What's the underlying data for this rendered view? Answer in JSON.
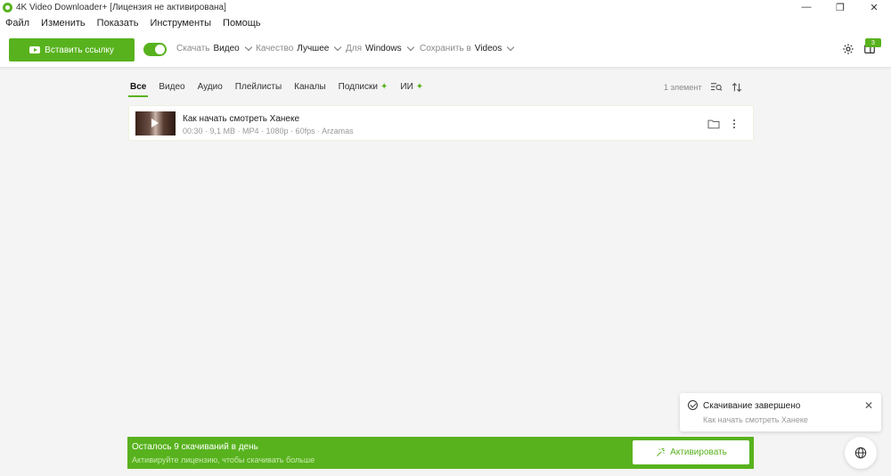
{
  "window": {
    "title": "4K Video Downloader+ [Лицензия не активирована]",
    "minimize": "—",
    "restore": "❐",
    "close": "✕"
  },
  "menu": [
    "Файл",
    "Изменить",
    "Показать",
    "Инструменты",
    "Помощь"
  ],
  "toolbar": {
    "paste_label": "Вставить ссылку",
    "download_label": "Скачать",
    "download_value": "Видео",
    "quality_label": "Качество",
    "quality_value": "Лучшее",
    "for_label": "Для",
    "for_value": "Windows",
    "save_label": "Сохранить в",
    "save_value": "Videos",
    "queue_badge": "3",
    "smart_mode": true
  },
  "tabs": [
    "Все",
    "Видео",
    "Аудио",
    "Плейлисты",
    "Каналы",
    "Подписки",
    "ИИ"
  ],
  "list": {
    "count": "1 элемент",
    "items": [
      {
        "title": "Как начать смотреть Ханеке",
        "meta": "00:30 · 9,1 MB · MP4 · 1080p · 60fps · Arzamas"
      }
    ]
  },
  "toast": {
    "title": "Скачивание завершено",
    "subtitle": "Как начать смотреть Ханеке"
  },
  "banner": {
    "line1": "Осталось 9 скачиваний в день",
    "line2": "Активируйте лицензию, чтобы скачивать больше",
    "activate_label": "Активировать"
  },
  "colors": {
    "accent": "#58b21e"
  }
}
